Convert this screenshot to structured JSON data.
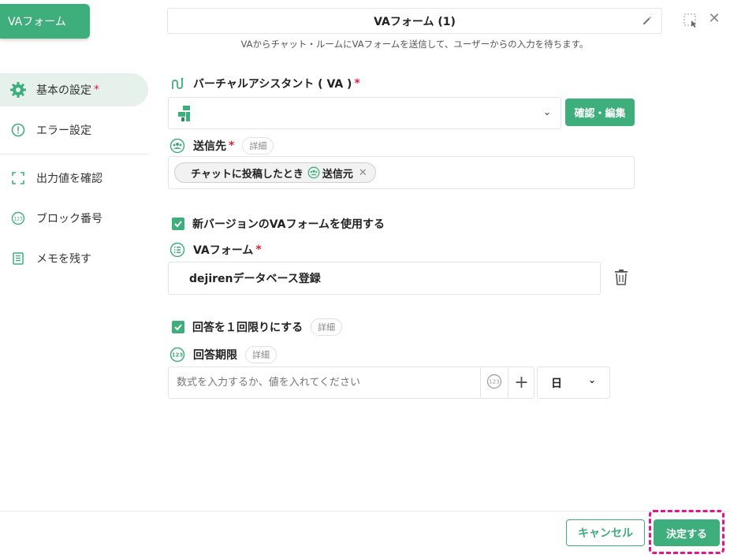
{
  "header": {
    "block_tag": "VAフォーム",
    "title": "VAフォーム (1)",
    "subtitle": "VAからチャット・ルームにVAフォームを送信して、ユーザーからの入力を待ちます。"
  },
  "sidebar": {
    "items": [
      {
        "label": "基本の設定",
        "required_mark": "*"
      },
      {
        "label": "エラー設定"
      },
      {
        "label": "出力値を確認"
      },
      {
        "label": "ブロック番号"
      },
      {
        "label": "メモを残す"
      }
    ]
  },
  "form": {
    "va": {
      "label": "バーチャルアシスタント ( VA )",
      "required_mark": "*",
      "edit_button": "確認・編集"
    },
    "destination": {
      "label": "送信先",
      "required_mark": "*",
      "detail": "詳細",
      "chip_text": "チャットに投稿したとき",
      "chip_tag": "送信元"
    },
    "new_version": {
      "label": "新バージョンのVAフォームを使用する",
      "checked": true
    },
    "va_form": {
      "label": "VAフォーム",
      "required_mark": "*",
      "value": "dejirenデータベース登録"
    },
    "once": {
      "label": "回答を１回限りにする",
      "detail": "詳細",
      "checked": true
    },
    "deadline": {
      "label": "回答期限",
      "detail": "詳細",
      "placeholder": "数式を入力するか、値を入れてください",
      "unit": "日"
    }
  },
  "footer": {
    "cancel": "キャンセル",
    "ok": "決定する"
  },
  "colors": {
    "accent": "#3fae7d",
    "required": "#e0203c",
    "highlight": "#e0178a"
  }
}
